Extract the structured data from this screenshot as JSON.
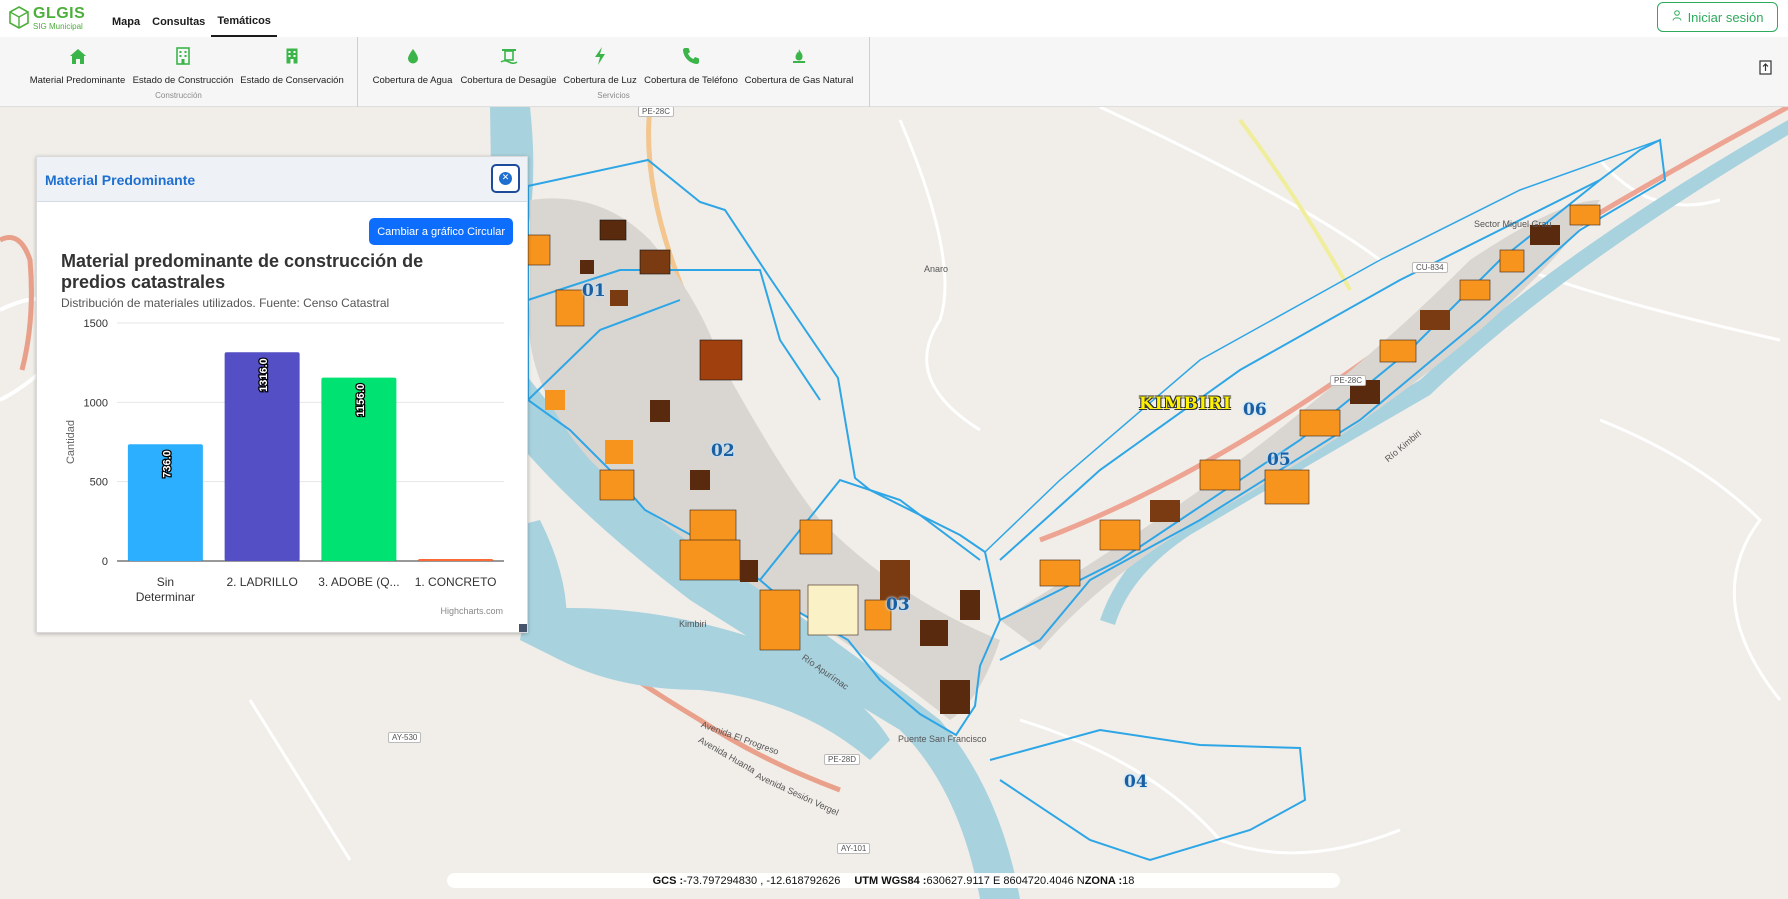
{
  "app": {
    "logo_name": "GLGIS",
    "logo_sub": "SIG Municipal"
  },
  "menu": [
    {
      "label": "Mapa",
      "active": false
    },
    {
      "label": "Consultas",
      "active": false
    },
    {
      "label": "Temáticos",
      "active": true
    }
  ],
  "login_label": "Iniciar sesión",
  "ribbon": {
    "groups": [
      {
        "name": "Construcción",
        "items": [
          {
            "label": "Material Predominante",
            "icon": "home-icon"
          },
          {
            "label": "Estado de Construcción",
            "icon": "building-icon"
          },
          {
            "label": "Estado de Conservación",
            "icon": "building-small-icon"
          }
        ]
      },
      {
        "name": "Servicios",
        "items": [
          {
            "label": "Cobertura de Agua",
            "icon": "water-drop-icon"
          },
          {
            "label": "Cobertura de Desagüe",
            "icon": "drain-icon"
          },
          {
            "label": "Cobertura de Luz",
            "icon": "lightning-icon"
          },
          {
            "label": "Cobertura de Teléfono",
            "icon": "phone-icon"
          },
          {
            "label": "Cobertura de Gas Natural",
            "icon": "gas-flame-icon"
          }
        ]
      }
    ]
  },
  "panel": {
    "title": "Material Predominante",
    "toggle_label": "Cambiar a gráfico Circular",
    "credits": "Highcharts.com"
  },
  "chart_data": {
    "type": "bar",
    "title": "Material predominante de construcción de predios catastrales",
    "subtitle": "Distribución de materiales utilizados. Fuente: Censo Catastral",
    "ylabel": "Cantidad",
    "xlabel": "",
    "categories": [
      "Sin Determinar",
      "2. LADRILLO",
      "3. ADOBE (Q...",
      "1. CONCRETO"
    ],
    "values": [
      736.0,
      1316.0,
      1156.0,
      0
    ],
    "value_labels": [
      "736.0",
      "1316.0",
      "1156.0",
      ""
    ],
    "colors": [
      "#2caffe",
      "#544fc5",
      "#00e272",
      "#fe6a35"
    ],
    "ylim": [
      0,
      1500
    ],
    "yticks": [
      0,
      500,
      1000,
      1500
    ],
    "grid": true,
    "legend": "none"
  },
  "map": {
    "sector_labels": [
      "01",
      "02",
      "03",
      "04",
      "05",
      "06"
    ],
    "town_label": "KIMBIRI",
    "place_labels": [
      "Sector Miguel Grau",
      "Anaro",
      "Puente San Francisco",
      "Kimbiri",
      "Avenida El Progreso",
      "Avenida Huanta",
      "Avenida Sesión Vergel",
      "Río Apurímac",
      "Río Kimbiri"
    ],
    "road_labels": [
      "PE-28C",
      "PE-28D",
      "AY-530",
      "AY-101",
      "CU-834",
      "PE-28C"
    ]
  },
  "status": {
    "gcs_label": "GCS :",
    "gcs_value": "-73.797294830 , -12.618792626",
    "utm_label": "UTM WGS84 :",
    "utm_value": "630627.9117 E 8604720.4046 N",
    "zone_label": "ZONA :",
    "zone_value": "18"
  }
}
